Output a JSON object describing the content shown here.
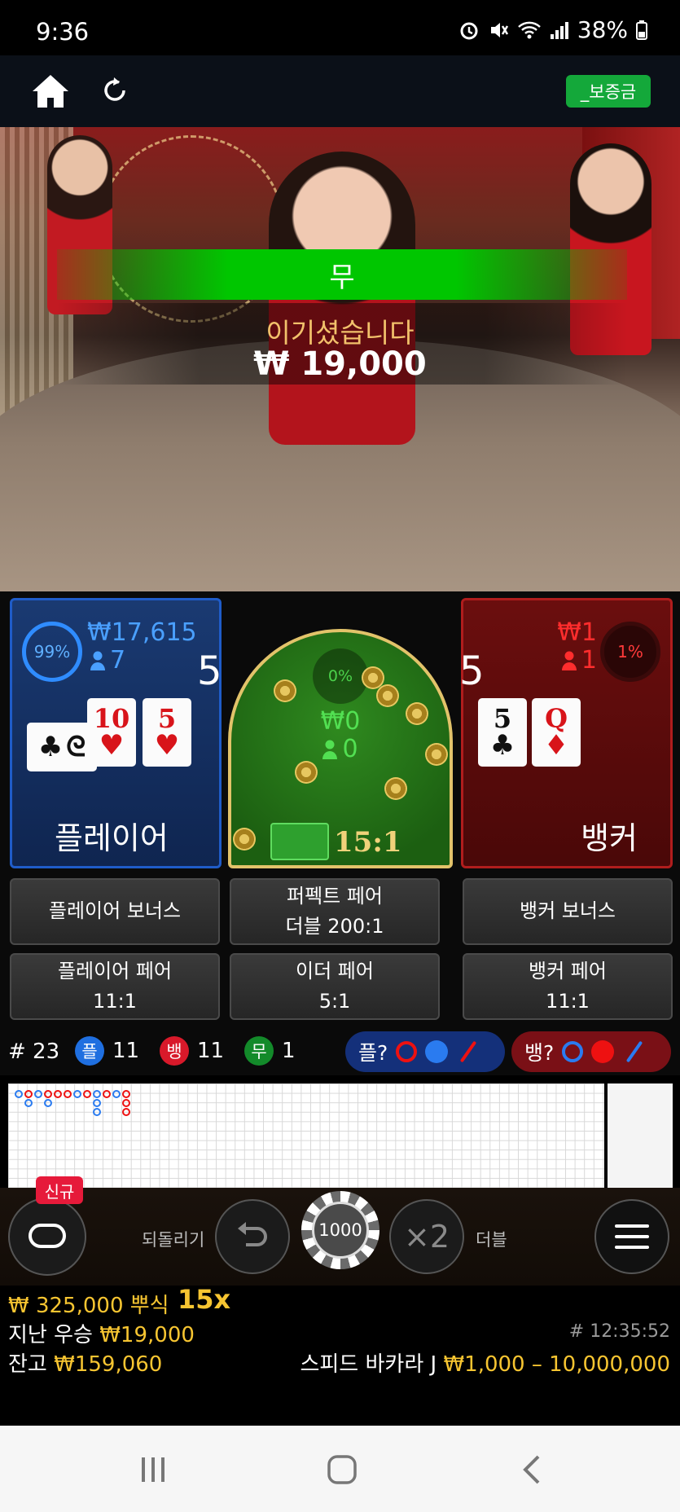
{
  "status_bar": {
    "time": "9:36",
    "battery": "38%",
    "icons": [
      "alarm-icon",
      "mute-icon",
      "wifi-icon",
      "signal-icon",
      "battery-icon"
    ]
  },
  "topbar": {
    "deposit_label": "_보증금",
    "icons": [
      "home-icon",
      "refresh-icon"
    ]
  },
  "video": {
    "result_label": "무",
    "win_message": "이기셨습니다",
    "win_amount": "₩ 19,000"
  },
  "player": {
    "percent": "99%",
    "amount": "₩17,615",
    "bettors": "7",
    "score": "5",
    "label": "플레이어",
    "cards": [
      {
        "rank": "10",
        "suit": "♥",
        "color": "red"
      },
      {
        "rank": "5",
        "suit": "♥",
        "color": "red"
      }
    ],
    "side_card_symbols": [
      "♣",
      "ᘓ"
    ]
  },
  "tie": {
    "percent": "0%",
    "amount": "₩0",
    "bettors": "0",
    "odds": "15:1"
  },
  "banker": {
    "percent": "1%",
    "amount": "₩1",
    "bettors": "1",
    "score": "5",
    "label": "뱅커",
    "cards": [
      {
        "rank": "5",
        "suit": "♣",
        "color": "black"
      },
      {
        "rank": "Q",
        "suit": "♦",
        "color": "red"
      }
    ]
  },
  "side_bets": {
    "player_bonus": "플레이어 보너스",
    "perfect_pair": {
      "line1": "퍼펙트 페어",
      "line2": "더블 200:1"
    },
    "banker_bonus": "뱅커 보너스",
    "player_pair": {
      "line1": "플레이어 페어",
      "line2": "11:1"
    },
    "either_pair": {
      "line1": "이더 페어",
      "line2": "5:1"
    },
    "banker_pair": {
      "line1": "뱅커 페어",
      "line2": "11:1"
    }
  },
  "stats": {
    "round_number": "# 23",
    "player": {
      "badge": "플",
      "count": "11"
    },
    "banker": {
      "badge": "뱅",
      "count": "11"
    },
    "tie": {
      "badge": "무",
      "count": "1"
    },
    "predict_player": "플?",
    "predict_banker": "뱅?"
  },
  "controls": {
    "new_badge": "신규",
    "undo_label": "되돌리기",
    "chip_value": "1000",
    "double_label": "더블",
    "double_icon_text": "×2"
  },
  "footer": {
    "jackpot": "₩ 325,000 뿌식",
    "jackpot_multiplier": "15x",
    "last_win_label": "지난 우승",
    "last_win_amount": "₩19,000",
    "balance_label": "잔고",
    "balance_amount": "₩159,060",
    "round_time": "# 12:35:52",
    "table_name": "스피드 바카라 J",
    "table_limits": "₩1,000 – 10,000,000"
  },
  "colors": {
    "player": "#1f5cc8",
    "banker": "#b01d1d",
    "tie": "#00c600",
    "gold": "#f7c531"
  }
}
